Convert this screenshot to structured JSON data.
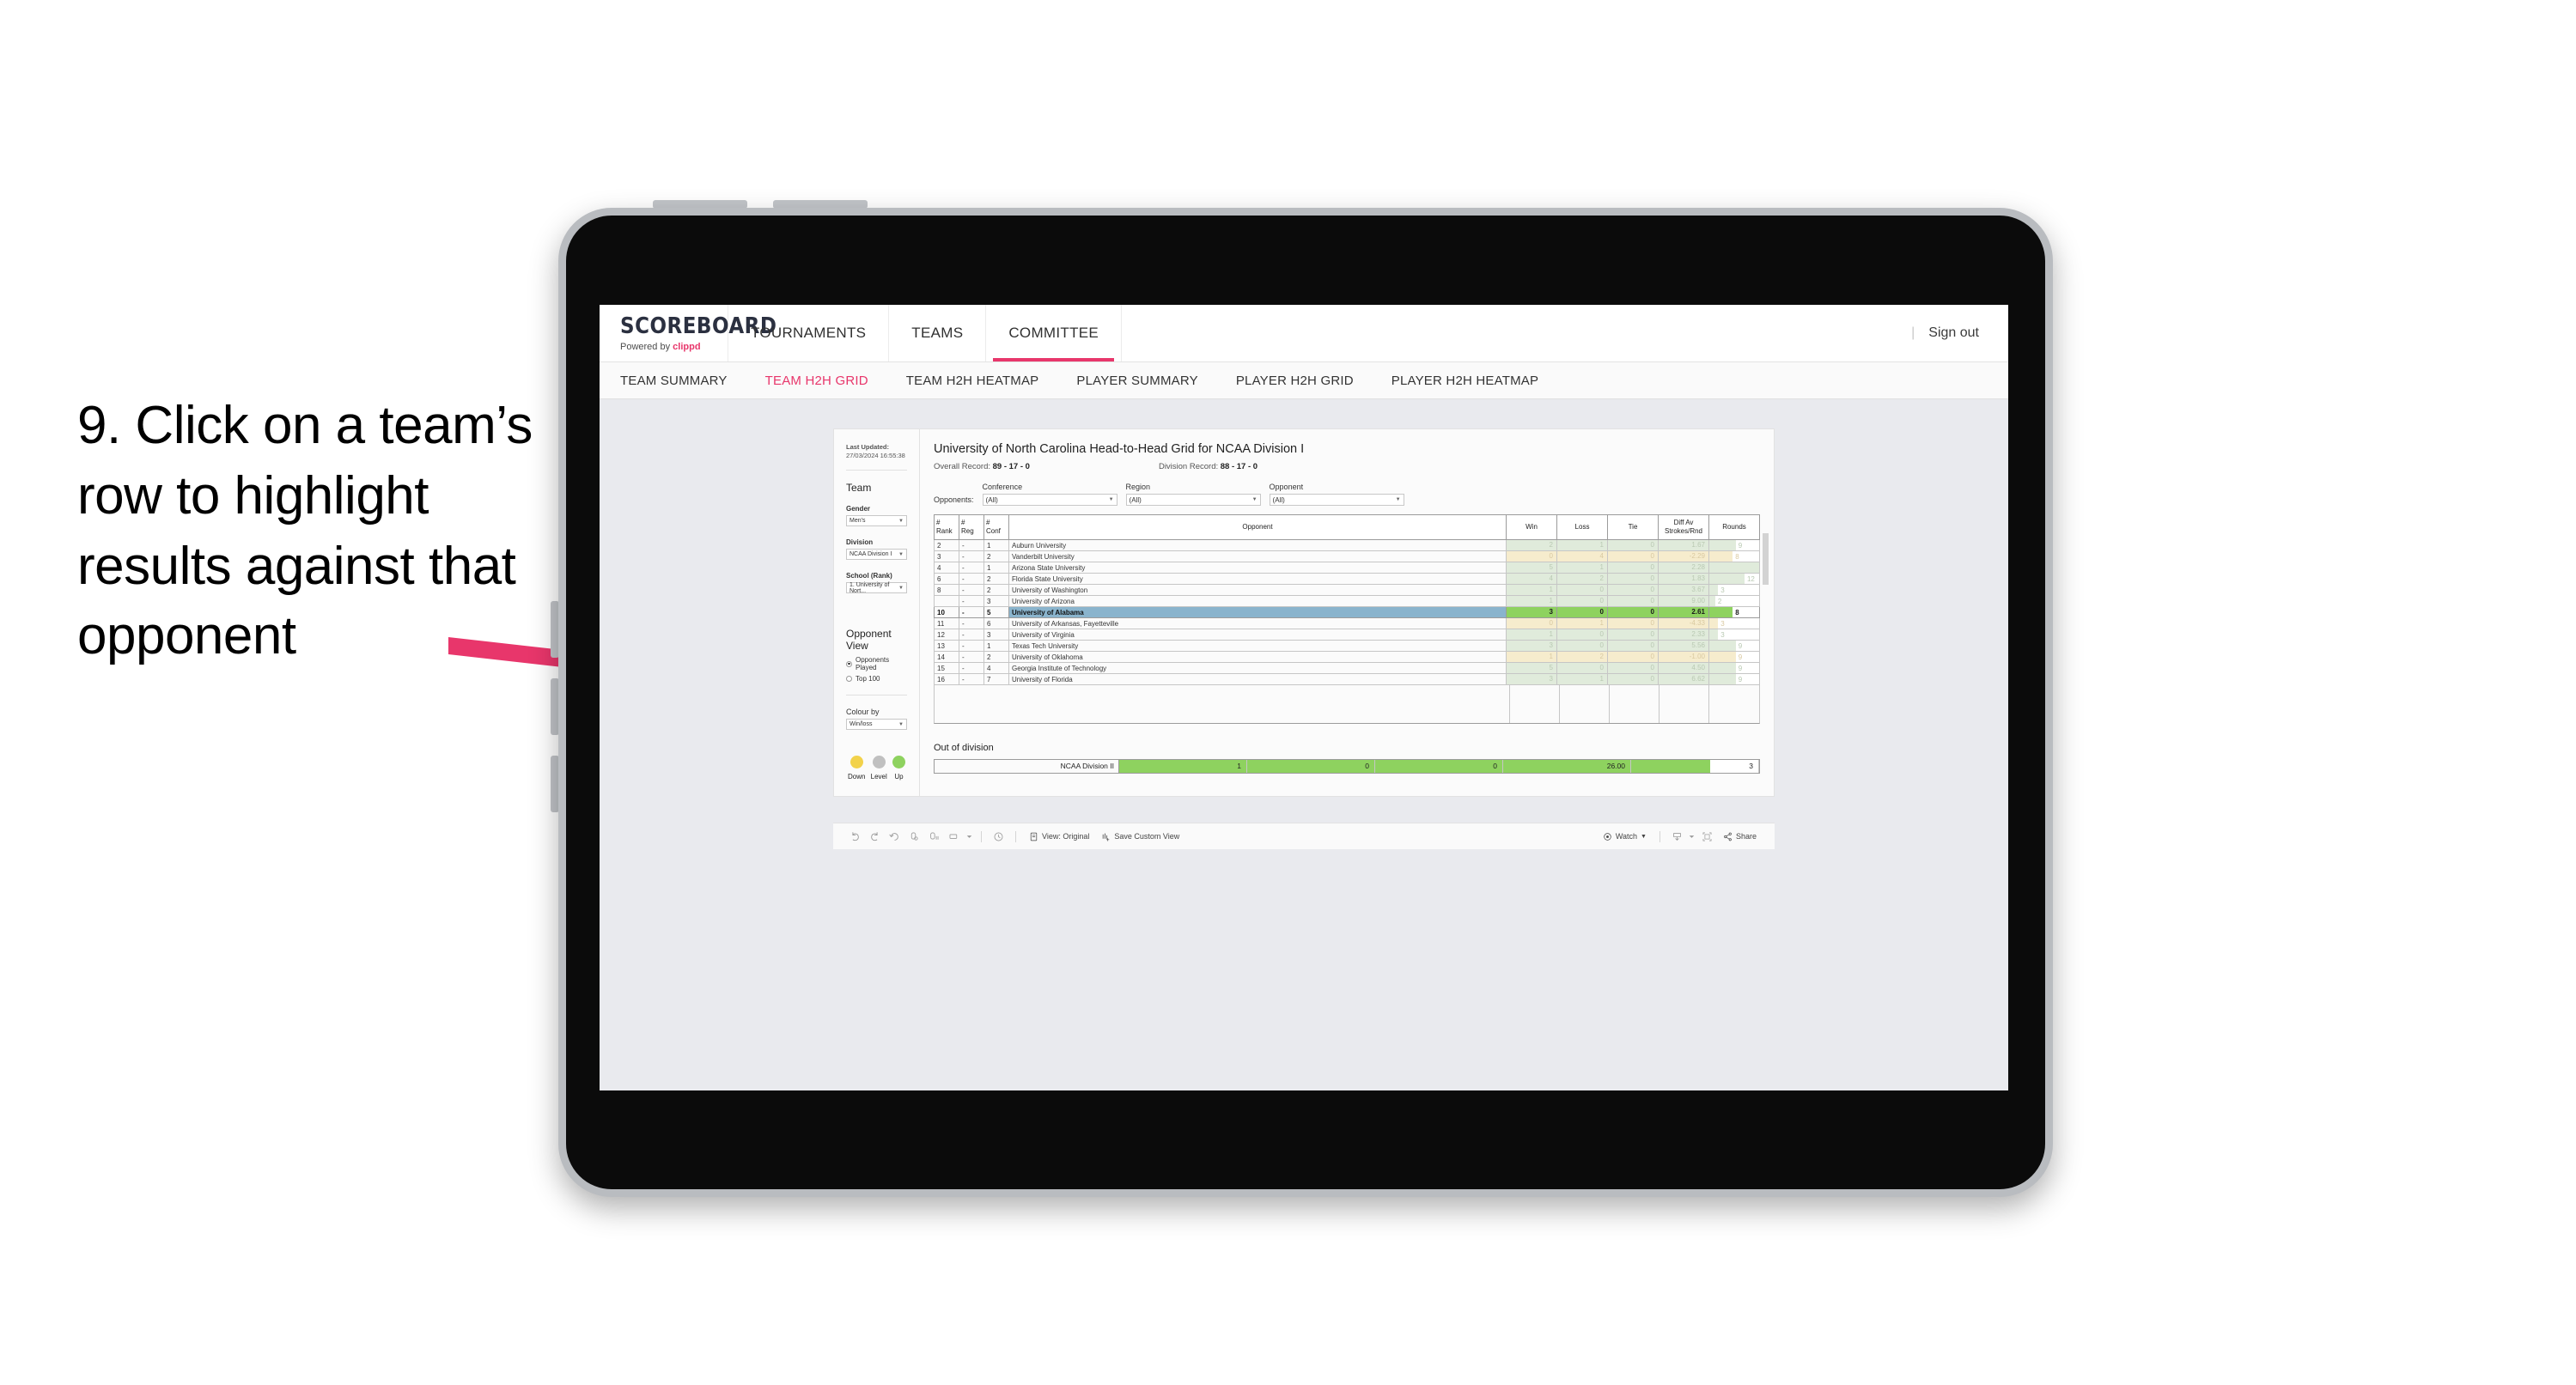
{
  "caption": "9. Click on a team’s row to highlight results against that opponent",
  "colors": {
    "accent_pink": "#e8366b",
    "arrow": "#e8366b",
    "up_green": "#8ed25f",
    "level_grey": "#c0c0c0",
    "down_yellow": "#f2d24b",
    "highlight_blue": "#8ab4cd"
  },
  "topbar": {
    "logo_main": "SCOREBOARD",
    "logo_sub_prefix": "Powered by ",
    "logo_sub_brand": "clippd",
    "nav": [
      {
        "label": "TOURNAMENTS",
        "active": false
      },
      {
        "label": "TEAMS",
        "active": false
      },
      {
        "label": "COMMITTEE",
        "active": true
      }
    ],
    "divider": "|",
    "sign_out": "Sign out"
  },
  "subnav": [
    {
      "label": "TEAM SUMMARY",
      "active": false
    },
    {
      "label": "TEAM H2H GRID",
      "active": true
    },
    {
      "label": "TEAM H2H HEATMAP",
      "active": false
    },
    {
      "label": "PLAYER SUMMARY",
      "active": false
    },
    {
      "label": "PLAYER H2H GRID",
      "active": false
    },
    {
      "label": "PLAYER H2H HEATMAP",
      "active": false
    }
  ],
  "sidebar": {
    "last_updated_label": "Last Updated:",
    "last_updated_value": "27/03/2024 16:55:38",
    "team_title": "Team",
    "gender_label": "Gender",
    "gender_value": "Men’s",
    "division_label": "Division",
    "division_value": "NCAA Division I",
    "school_label": "School (Rank)",
    "school_value": "1. University of Nort...",
    "opponent_view_title": "Opponent View",
    "opponent_view_options": [
      {
        "label": "Opponents Played",
        "selected": true
      },
      {
        "label": "Top 100",
        "selected": false
      }
    ],
    "colour_by_label": "Colour by",
    "colour_by_value": "Win/loss",
    "legend": [
      {
        "label": "Down",
        "color": "#f2d24b"
      },
      {
        "label": "Level",
        "color": "#c0c0c0"
      },
      {
        "label": "Up",
        "color": "#8ed25f"
      }
    ]
  },
  "main": {
    "title": "University of North Carolina Head-to-Head Grid for NCAA Division I",
    "overall_record_label": "Overall Record:",
    "overall_record_value": "89 - 17 - 0",
    "division_record_label": "Division Record:",
    "division_record_value": "88 - 17 - 0",
    "opponents_label": "Opponents:",
    "filters": [
      {
        "label": "Conference",
        "value": "(All)"
      },
      {
        "label": "Region",
        "value": "(All)"
      },
      {
        "label": "Opponent",
        "value": "(All)"
      }
    ],
    "columns": [
      "# Rank",
      "# Reg",
      "# Conf",
      "Opponent",
      "Win",
      "Loss",
      "Tie",
      "Diff Av Strokes/Rnd",
      "Rounds"
    ],
    "column_headers": {
      "rank_l1": "#",
      "rank_l2": "Rank",
      "reg_l1": "#",
      "reg_l2": "Reg",
      "conf_l1": "#",
      "conf_l2": "Conf",
      "opponent": "Opponent",
      "win": "Win",
      "loss": "Loss",
      "tie": "Tie",
      "diff_l1": "Diff Av",
      "diff_l2": "Strokes/Rnd",
      "rounds": "Rounds"
    },
    "rows": [
      {
        "rank": "2",
        "reg": "-",
        "conf": "1",
        "opponent": "Auburn University",
        "win": "2",
        "loss": "1",
        "tie": "0",
        "diff": "1.67",
        "rounds": "9",
        "tone": "up",
        "highlighted": false
      },
      {
        "rank": "3",
        "reg": "-",
        "conf": "2",
        "opponent": "Vanderbilt University",
        "win": "0",
        "loss": "4",
        "tie": "0",
        "diff": "-2.29",
        "rounds": "8",
        "tone": "down",
        "highlighted": false
      },
      {
        "rank": "4",
        "reg": "-",
        "conf": "1",
        "opponent": "Arizona State University",
        "win": "5",
        "loss": "1",
        "tie": "0",
        "diff": "2.28",
        "rounds": "17",
        "tone": "up",
        "highlighted": false
      },
      {
        "rank": "6",
        "reg": "-",
        "conf": "2",
        "opponent": "Florida State University",
        "win": "4",
        "loss": "2",
        "tie": "0",
        "diff": "1.83",
        "rounds": "12",
        "tone": "up",
        "highlighted": false
      },
      {
        "rank": "8",
        "reg": "-",
        "conf": "2",
        "opponent": "University of Washington",
        "win": "1",
        "loss": "0",
        "tie": "0",
        "diff": "3.67",
        "rounds": "3",
        "tone": "up",
        "highlighted": false
      },
      {
        "rank": "",
        "reg": "-",
        "conf": "3",
        "opponent": "University of Arizona",
        "win": "1",
        "loss": "0",
        "tie": "0",
        "diff": "9.00",
        "rounds": "2",
        "tone": "up",
        "highlighted": false
      },
      {
        "rank": "10",
        "reg": "-",
        "conf": "5",
        "opponent": "University of Alabama",
        "win": "3",
        "loss": "0",
        "tie": "0",
        "diff": "2.61",
        "rounds": "8",
        "tone": "up",
        "highlighted": true
      },
      {
        "rank": "11",
        "reg": "-",
        "conf": "6",
        "opponent": "University of Arkansas, Fayetteville",
        "win": "0",
        "loss": "1",
        "tie": "0",
        "diff": "-4.33",
        "rounds": "3",
        "tone": "down",
        "highlighted": false
      },
      {
        "rank": "12",
        "reg": "-",
        "conf": "3",
        "opponent": "University of Virginia",
        "win": "1",
        "loss": "0",
        "tie": "0",
        "diff": "2.33",
        "rounds": "3",
        "tone": "up",
        "highlighted": false
      },
      {
        "rank": "13",
        "reg": "-",
        "conf": "1",
        "opponent": "Texas Tech University",
        "win": "3",
        "loss": "0",
        "tie": "0",
        "diff": "5.56",
        "rounds": "9",
        "tone": "up",
        "highlighted": false
      },
      {
        "rank": "14",
        "reg": "-",
        "conf": "2",
        "opponent": "University of Oklahoma",
        "win": "1",
        "loss": "2",
        "tie": "0",
        "diff": "-1.00",
        "rounds": "9",
        "tone": "down",
        "highlighted": false
      },
      {
        "rank": "15",
        "reg": "-",
        "conf": "4",
        "opponent": "Georgia Institute of Technology",
        "win": "5",
        "loss": "0",
        "tie": "0",
        "diff": "4.50",
        "rounds": "9",
        "tone": "up",
        "highlighted": false
      },
      {
        "rank": "16",
        "reg": "-",
        "conf": "7",
        "opponent": "University of Florida",
        "win": "3",
        "loss": "1",
        "tie": "0",
        "diff": "6.62",
        "rounds": "9",
        "tone": "up",
        "highlighted": false
      }
    ],
    "out_of_division_title": "Out of division",
    "out_of_division_row": {
      "label": "NCAA Division II",
      "win": "1",
      "loss": "0",
      "tie": "0",
      "diff": "26.00",
      "rounds": "3"
    }
  },
  "toolbar": {
    "icons": [
      "undo-icon",
      "redo-icon",
      "revert-icon",
      "refresh-icon",
      "pause-icon",
      "rectangle-select-icon"
    ],
    "view_label": "View: Original",
    "save_view_label": "Save Custom View",
    "watch_label": "Watch",
    "share_label": "Share"
  },
  "chart_data": {
    "type": "table",
    "title": "University of North Carolina Head-to-Head Grid for NCAA Division I",
    "categories": [
      "Auburn University",
      "Vanderbilt University",
      "Arizona State University",
      "Florida State University",
      "University of Washington",
      "University of Arizona",
      "University of Alabama",
      "University of Arkansas, Fayetteville",
      "University of Virginia",
      "Texas Tech University",
      "University of Oklahoma",
      "Georgia Institute of Technology",
      "University of Florida"
    ],
    "series": [
      {
        "name": "Win",
        "values": [
          2,
          0,
          5,
          4,
          1,
          1,
          3,
          0,
          1,
          3,
          1,
          5,
          3
        ]
      },
      {
        "name": "Loss",
        "values": [
          1,
          4,
          1,
          2,
          0,
          0,
          0,
          1,
          0,
          0,
          2,
          0,
          1
        ]
      },
      {
        "name": "Tie",
        "values": [
          0,
          0,
          0,
          0,
          0,
          0,
          0,
          0,
          0,
          0,
          0,
          0,
          0
        ]
      },
      {
        "name": "Diff Av Strokes/Rnd",
        "values": [
          1.67,
          -2.29,
          2.28,
          1.83,
          3.67,
          9.0,
          2.61,
          -4.33,
          2.33,
          5.56,
          -1.0,
          4.5,
          6.62
        ]
      },
      {
        "name": "Rounds",
        "values": [
          9,
          8,
          17,
          12,
          3,
          2,
          8,
          3,
          3,
          9,
          9,
          9,
          9
        ]
      }
    ],
    "xlabel": "Opponent",
    "ylabel": "",
    "legend_position": "sidebar"
  }
}
